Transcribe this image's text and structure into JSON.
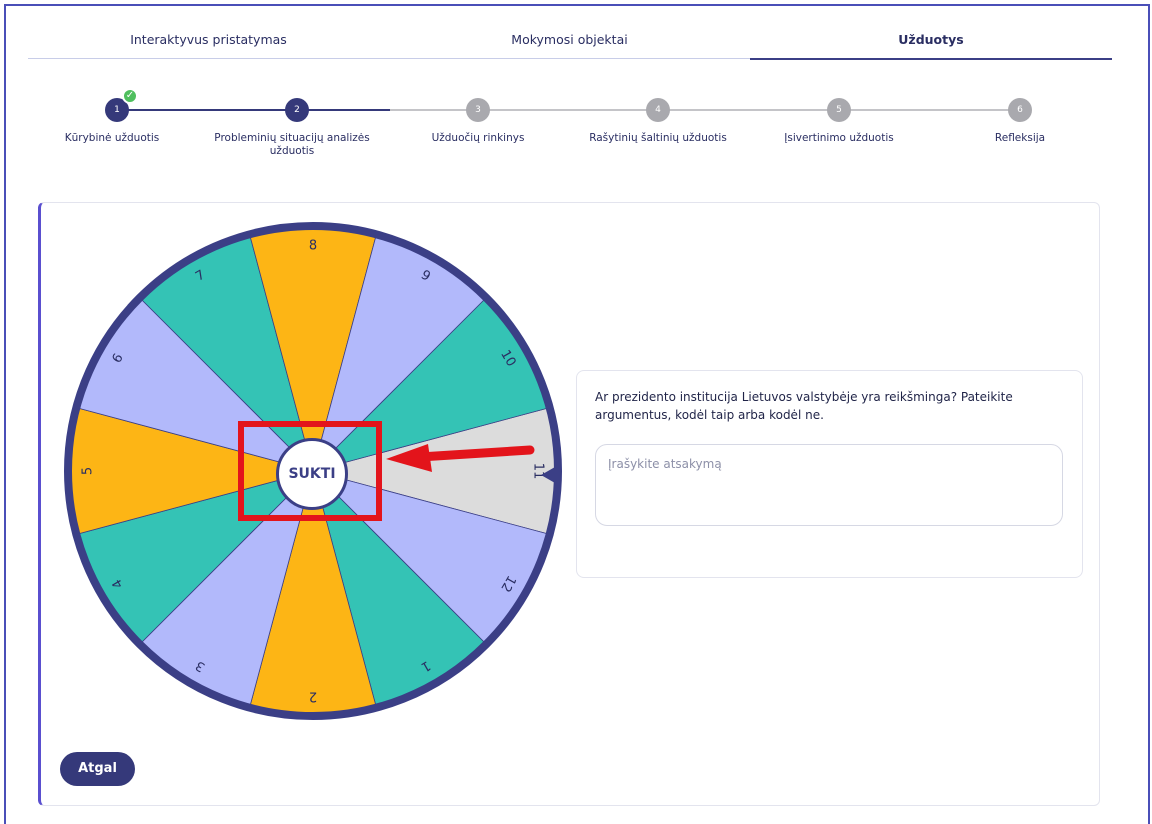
{
  "tabs": [
    {
      "label": "Interaktyvus pristatymas"
    },
    {
      "label": "Mokymosi objektai"
    },
    {
      "label": "Užduotys"
    }
  ],
  "active_tab": 2,
  "steps": [
    {
      "number": "1",
      "label": "Kūrybinė užduotis",
      "state": "done"
    },
    {
      "number": "2",
      "label": "Probleminių situacijų analizės užduotis",
      "state": "current"
    },
    {
      "number": "3",
      "label": "Užduočių rinkinys",
      "state": "todo"
    },
    {
      "number": "4",
      "label": "Rašytinių šaltinių užduotis",
      "state": "todo"
    },
    {
      "number": "5",
      "label": "Įsivertinimo užduotis",
      "state": "todo"
    },
    {
      "number": "6",
      "label": "Refleksija",
      "state": "todo"
    }
  ],
  "wheel": {
    "segments": [
      "11",
      "12",
      "1",
      "2",
      "3",
      "4",
      "5",
      "6",
      "7",
      "8",
      "9",
      "10"
    ],
    "colors": {
      "11": "#dcdcdc",
      "12": "#b2b9fb",
      "1": "#34c3b5",
      "2": "#fdb515",
      "3": "#b2b9fb",
      "4": "#34c3b5",
      "5": "#fdb515",
      "6": "#b2b9fb",
      "7": "#34c3b5",
      "8": "#fdb515",
      "9": "#b2b9fb",
      "10": "#34c3b5"
    },
    "rim_color": "#3b3f86",
    "spin_label": "SUKTI",
    "selected": "11"
  },
  "question": "Ar prezidento institucija Lietuvos valstybėje yra reikšminga? Pateikite argumentus, kodėl taip arba kodėl ne.",
  "answer": {
    "value": "",
    "placeholder": "Įrašykite atsakymą"
  },
  "back_label": "Atgal",
  "colors": {
    "primary": "#35397a",
    "highlight": "#e3141b",
    "done": "#4fbf5e"
  }
}
